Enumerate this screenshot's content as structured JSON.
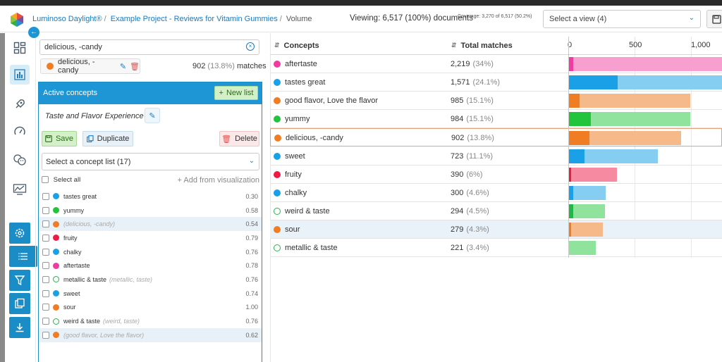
{
  "header": {
    "app_name": "Luminoso Daylight®",
    "project": "Example Project - Reviews for Vitamin Gummies",
    "page": "Volume",
    "viewing": "Viewing: 6,517 (100%) documents",
    "coverage": "Coverage: 3,270 of 6,517 (50.2%)",
    "view_select": "Select a view (4)"
  },
  "search": {
    "value": "delicious, -candy"
  },
  "selected_concept": {
    "label": "delicious, -candy",
    "color": "#f07c24",
    "matches": "902",
    "matches_pct": "(13.8%)",
    "matches_suffix": "matches"
  },
  "active_panel": {
    "title": "Active concepts",
    "new_list": "New list",
    "list_name": "Taste and Flavor Experience *",
    "save": "Save",
    "duplicate": "Duplicate",
    "delete": "Delete",
    "concept_list_select": "Select a concept list (17)",
    "select_all": "Select all",
    "add_from_viz": "Add from visualization",
    "items": [
      {
        "label": "tastes great",
        "sub": "",
        "score": "0.30",
        "color": "#1aa0e6",
        "hollow": false,
        "muted": false
      },
      {
        "label": "yummy",
        "sub": "",
        "score": "0.58",
        "color": "#22c43e",
        "hollow": false,
        "muted": false
      },
      {
        "label": "(delicious, -candy)",
        "sub": "",
        "score": "0.54",
        "color": "#f07c24",
        "hollow": false,
        "muted": true
      },
      {
        "label": "fruity",
        "sub": "",
        "score": "0.79",
        "color": "#ee1c44",
        "hollow": false,
        "muted": false
      },
      {
        "label": "chalky",
        "sub": "",
        "score": "0.76",
        "color": "#1aa0e6",
        "hollow": false,
        "muted": false
      },
      {
        "label": "aftertaste",
        "sub": "",
        "score": "0.78",
        "color": "#f03ca0",
        "hollow": false,
        "muted": false
      },
      {
        "label": "metallic & taste",
        "sub": "(metallic, taste)",
        "score": "0.76",
        "color": "#22b548",
        "hollow": true,
        "muted": false
      },
      {
        "label": "sweet",
        "sub": "",
        "score": "0.74",
        "color": "#1aa0e6",
        "hollow": false,
        "muted": false
      },
      {
        "label": "sour",
        "sub": "",
        "score": "1.00",
        "color": "#f07c24",
        "hollow": false,
        "muted": false
      },
      {
        "label": "weird & taste",
        "sub": "(weird, taste)",
        "score": "0.76",
        "color": "#22b548",
        "hollow": true,
        "muted": false
      },
      {
        "label": "(good flavor, Love the flavor)",
        "sub": "",
        "score": "0.62",
        "color": "#f07c24",
        "hollow": false,
        "muted": true
      }
    ]
  },
  "table": {
    "col_concepts": "Concepts",
    "col_total": "Total matches",
    "axis_ticks": [
      "0",
      "500",
      "1,000"
    ],
    "rows": [
      {
        "label": "aftertaste",
        "count": "2,219",
        "pct": "(34%)",
        "total": 2219,
        "exact": 40,
        "color": "#f03ca0",
        "bg": "#f7a0cf",
        "hollow": false,
        "sel": false,
        "outline": false
      },
      {
        "label": "tastes great",
        "count": "1,571",
        "pct": "(24.1%)",
        "total": 1571,
        "exact": 395,
        "color": "#1aa0e6",
        "bg": "#86cdf2",
        "hollow": false,
        "sel": false,
        "outline": false
      },
      {
        "label": "good flavor, Love the flavor",
        "count": "985",
        "pct": "(15.1%)",
        "total": 985,
        "exact": 90,
        "color": "#f07c24",
        "bg": "#f6b98a",
        "hollow": false,
        "sel": false,
        "outline": false
      },
      {
        "label": "yummy",
        "count": "984",
        "pct": "(15.1%)",
        "total": 984,
        "exact": 180,
        "color": "#22c43e",
        "bg": "#8fe39d",
        "hollow": false,
        "sel": false,
        "outline": false
      },
      {
        "label": "delicious, -candy",
        "count": "902",
        "pct": "(13.8%)",
        "total": 902,
        "exact": 165,
        "color": "#f07c24",
        "bg": "#f6b98a",
        "hollow": false,
        "sel": false,
        "outline": true
      },
      {
        "label": "sweet",
        "count": "723",
        "pct": "(11.1%)",
        "total": 723,
        "exact": 130,
        "color": "#1aa0e6",
        "bg": "#86cdf2",
        "hollow": false,
        "sel": false,
        "outline": false
      },
      {
        "label": "fruity",
        "count": "390",
        "pct": "(6%)",
        "total": 390,
        "exact": 25,
        "color": "#ee1c44",
        "bg": "#f58aa0",
        "hollow": false,
        "sel": false,
        "outline": false
      },
      {
        "label": "chalky",
        "count": "300",
        "pct": "(4.6%)",
        "total": 300,
        "exact": 40,
        "color": "#1aa0e6",
        "bg": "#86cdf2",
        "hollow": false,
        "sel": false,
        "outline": false
      },
      {
        "label": "weird & taste",
        "count": "294",
        "pct": "(4.5%)",
        "total": 294,
        "exact": 40,
        "color": "#22b548",
        "bg": "#8fe39d",
        "hollow": true,
        "sel": false,
        "outline": false
      },
      {
        "label": "sour",
        "count": "279",
        "pct": "(4.3%)",
        "total": 279,
        "exact": 20,
        "color": "#f07c24",
        "bg": "#f6b98a",
        "hollow": false,
        "sel": true,
        "outline": false
      },
      {
        "label": "metallic & taste",
        "count": "221",
        "pct": "(3.4%)",
        "total": 221,
        "exact": 0,
        "color": "#22b548",
        "bg": "#8fe39d",
        "hollow": true,
        "sel": false,
        "outline": false
      }
    ]
  }
}
